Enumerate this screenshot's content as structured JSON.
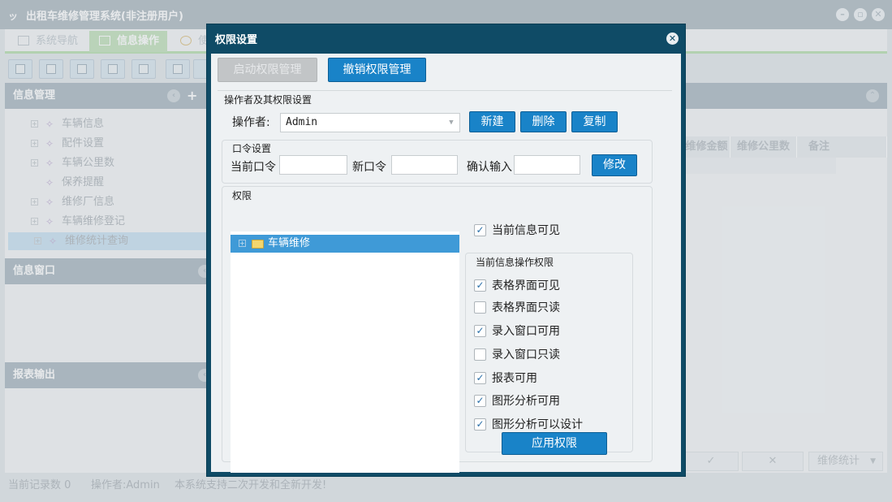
{
  "app": {
    "title": "出租车维修管理系统(非注册用户)",
    "tabs": [
      {
        "label": "系统导航"
      },
      {
        "label": "信息操作"
      },
      {
        "label": "使"
      }
    ]
  },
  "sidebar": {
    "section1": "信息管理",
    "items": [
      {
        "label": "车辆信息"
      },
      {
        "label": "配件设置"
      },
      {
        "label": "车辆公里数"
      },
      {
        "label": "保养提醒"
      },
      {
        "label": "维修厂信息"
      },
      {
        "label": "车辆维修登记"
      },
      {
        "label": "维修统计查询"
      }
    ],
    "section2": "信息窗口",
    "section3": "报表输出"
  },
  "main": {
    "columns": [
      "维修金额",
      "维修公里数",
      "备注"
    ],
    "bottom_select": "维修统计",
    "ok_mark": "✓",
    "cancel_mark": "✕"
  },
  "status": {
    "records": "当前记录数 0",
    "operator": "操作者:Admin",
    "note": "本系统支持二次开发和全新开发!"
  },
  "dialog": {
    "title": "权限设置",
    "enable_btn": "启动权限管理",
    "revoke_btn": "撤销权限管理",
    "operator_group_title": "操作者及其权限设置",
    "operator_label": "操作者:",
    "operator_value": "Admin",
    "new_btn": "新建",
    "delete_btn": "删除",
    "copy_btn": "复制",
    "password_group": "口令设置",
    "current_pwd": "当前口令",
    "new_pwd": "新口令",
    "confirm_pwd": "确认输入",
    "modify_btn": "修改",
    "perm_group": "权限",
    "tree_node": "车辆维修",
    "visible_chk": {
      "label": "当前信息可见",
      "checked": true
    },
    "op_perm_group": "当前信息操作权限",
    "perms": [
      {
        "label": "表格界面可见",
        "checked": true
      },
      {
        "label": "表格界面只读",
        "checked": false
      },
      {
        "label": "录入窗口可用",
        "checked": true
      },
      {
        "label": "录入窗口只读",
        "checked": false
      },
      {
        "label": "报表可用",
        "checked": true
      },
      {
        "label": "图形分析可用",
        "checked": true
      },
      {
        "label": "图形分析可以设计",
        "checked": true
      }
    ],
    "apply_btn": "应用权限"
  }
}
